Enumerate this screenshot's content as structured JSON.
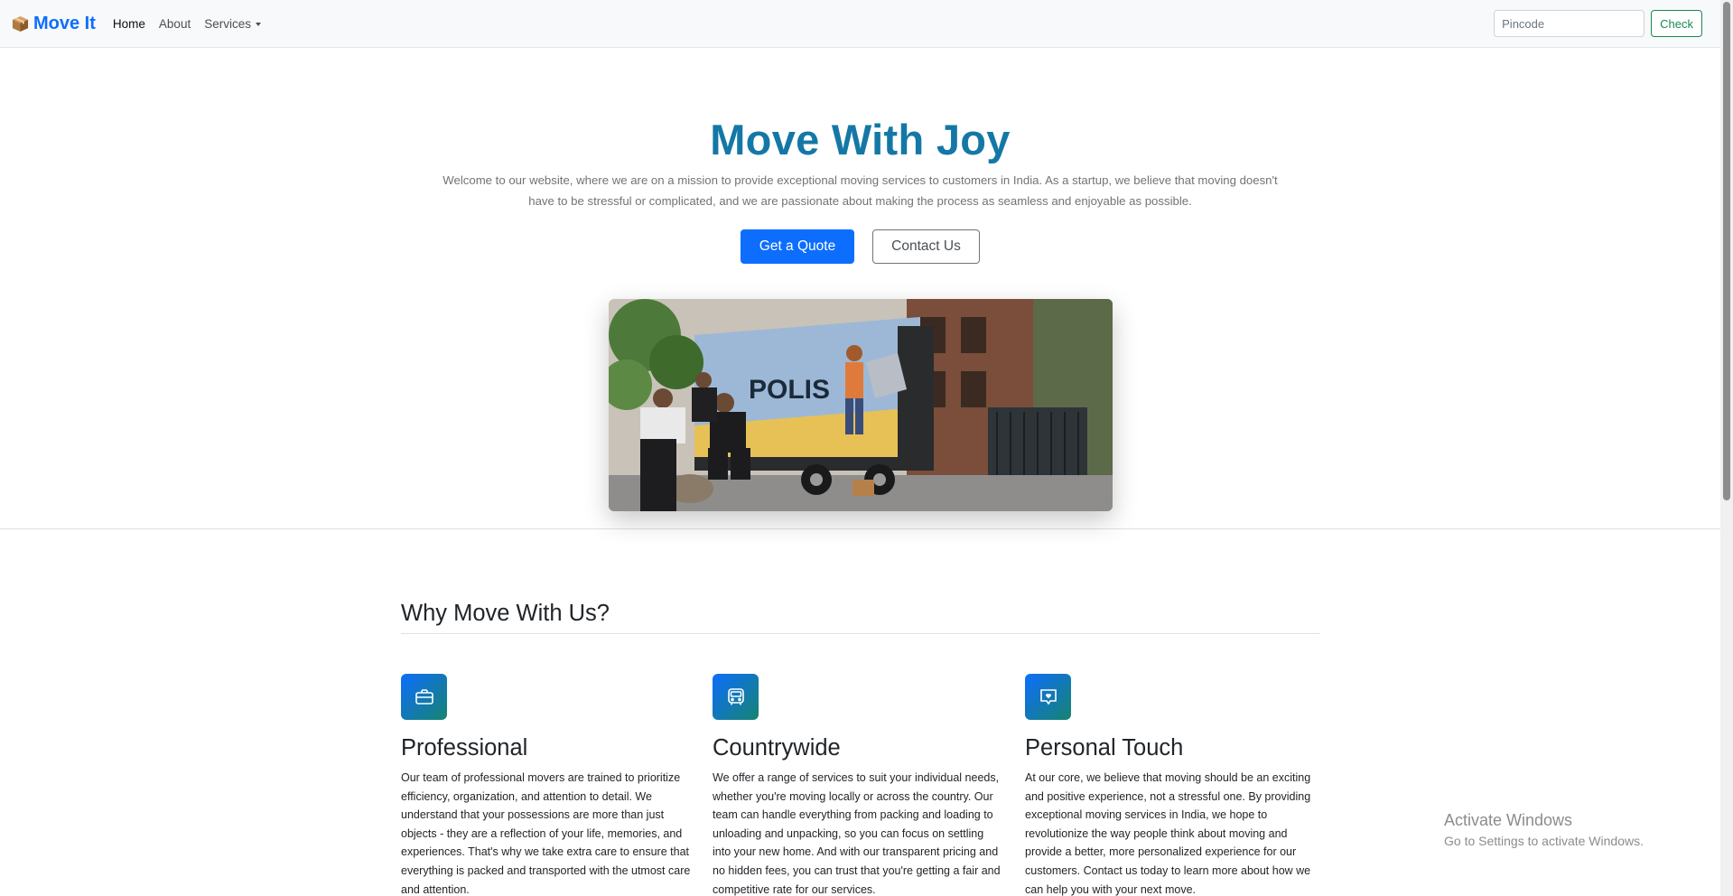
{
  "navbar": {
    "brand": "Move It",
    "links": [
      "Home",
      "About",
      "Services"
    ],
    "pincode_placeholder": "Pincode",
    "check_label": "Check"
  },
  "hero": {
    "title": "Move With Joy",
    "lead": "Welcome to our website, where we are on a mission to provide exceptional moving services to customers in India. As a startup, we believe that moving doesn't have to be stressful or complicated, and we are passionate about making the process as seamless and enjoyable as possible.",
    "primary_button": "Get a Quote",
    "secondary_button": "Contact Us",
    "image_alt": "Movers loading a truck"
  },
  "why": {
    "title": "Why Move With Us?",
    "features": [
      {
        "icon": "briefcase-icon",
        "title": "Professional",
        "text": "Our team of professional movers are trained to prioritize efficiency, organization, and attention to detail. We understand that your possessions are more than just objects - they are a reflection of your life, memories, and experiences. That's why we take extra care to ensure that everything is packed and transported with the utmost care and attention."
      },
      {
        "icon": "bus-icon",
        "title": "Countrywide",
        "text": "We offer a range of services to suit your individual needs, whether you're moving locally or across the country. Our team can handle everything from packing and loading to unloading and unpacking, so you can focus on settling into your new home. And with our transparent pricing and no hidden fees, you can trust that you're getting a fair and competitive rate for our services."
      },
      {
        "icon": "chat-heart-icon",
        "title": "Personal Touch",
        "text": "At our core, we believe that moving should be an exciting and positive experience, not a stressful one. By providing exceptional moving services in India, we hope to revolutionize the way people think about moving and provide a better, more personalized experience for our customers. Contact us today to learn more about how we can help you with your next move."
      }
    ]
  },
  "watermark": {
    "line1": "Activate Windows",
    "line2": "Go to Settings to activate Windows."
  },
  "colors": {
    "brand": "#0d6efd",
    "hero_title": "#1478a6",
    "success": "#198754"
  }
}
